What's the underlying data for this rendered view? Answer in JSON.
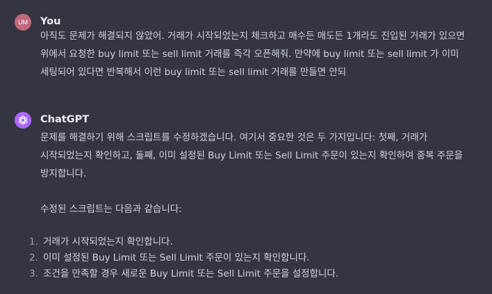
{
  "user": {
    "avatar_initials": "UM",
    "avatar_color": "#c0697d",
    "name": "You",
    "message": "아직도 문제가 해결되지 않았어. 거래가 시작되었는지 체크하고 매수든 매도든 1개라도 진입된 거래가 있으면 위에서 요청한 buy limit 또는 sell limit 거래를 즉각 오픈해줘. 만약에 buy limit 또는 sell limit 가 이미 세팅되어 있다면 반복해서 이런 buy limit 또는 sell limit 거래를 만들면 안되"
  },
  "assistant": {
    "avatar_icon": "openai-logo-icon",
    "avatar_color": "#ab68ff",
    "name": "ChatGPT",
    "paragraph1": "문제를 해결하기 위해 스크립트를 수정하겠습니다. 여기서 중요한 것은 두 가지입니다: 첫째, 거래가 시작되었는지 확인하고, 둘째, 이미 설정된 Buy Limit 또는 Sell Limit 주문이 있는지 확인하여 중복 주문을 방지합니다.",
    "paragraph2": "수정된 스크립트는 다음과 같습니다:",
    "list": [
      {
        "num": "1.",
        "text": "거래가 시작되었는지 확인합니다."
      },
      {
        "num": "2.",
        "text": "이미 설정된 Buy Limit 또는 Sell Limit 주문이 있는지 확인합니다."
      },
      {
        "num": "3.",
        "text": "조건을 만족할 경우 새로운 Buy Limit 또는 Sell Limit 주문을 설정합니다."
      }
    ]
  }
}
